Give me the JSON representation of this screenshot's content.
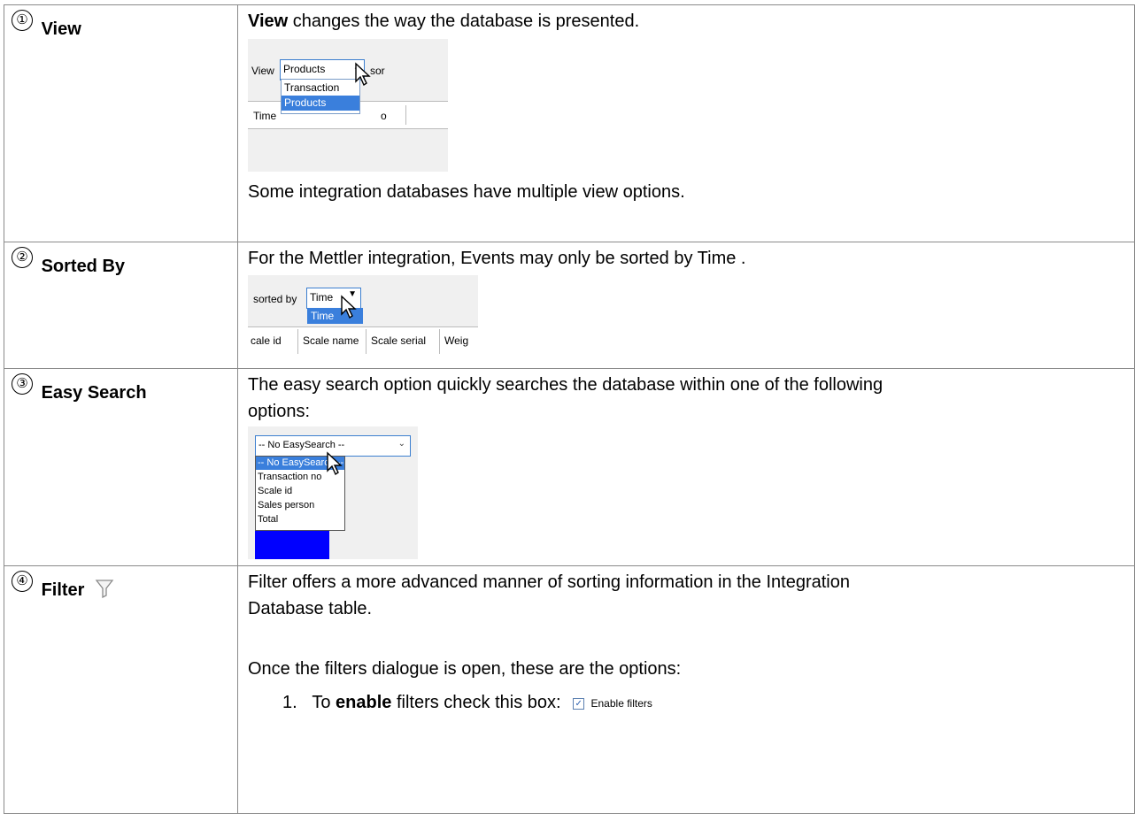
{
  "rows": [
    {
      "num": "①",
      "label": "View",
      "line1_bold": "View",
      "line1_rest": " changes the way the database is presented.",
      "shot": {
        "view_label": "View",
        "selected": "Products",
        "sort_fragment": "sor",
        "options": [
          "Transaction",
          "Products"
        ],
        "col_left": "Time",
        "col_right": "o"
      },
      "line2": "Some integration databases have multiple view options."
    },
    {
      "num": "②",
      "label": "Sorted By",
      "line1": "For the Mettler integration, Events may only be sorted by Time .",
      "shot": {
        "sorted_by_label": "sorted by",
        "selected": "Time",
        "option": "Time",
        "columns": [
          "cale id",
          "Scale name",
          "Scale serial",
          "Weig"
        ]
      }
    },
    {
      "num": "③",
      "label": "Easy Search",
      "line1": "The easy search option quickly searches the database within one of the following",
      "line2": "options:",
      "shot": {
        "selected": "-- No EasySearch --",
        "options": [
          "-- No EasySearch --",
          "Transaction no",
          "Scale id",
          "Sales person",
          "Total"
        ]
      }
    },
    {
      "num": "④",
      "label": "Filter",
      "line1": "Filter offers a more advanced manner of sorting information in the Integration",
      "line2": "Database table.",
      "line3": "Once the filters dialogue is open, these are the options:",
      "list_num": "1.",
      "list_pre": "To ",
      "list_bold": "enable",
      "list_post": " filters check this box:",
      "checkbox_label": "Enable filters"
    }
  ]
}
